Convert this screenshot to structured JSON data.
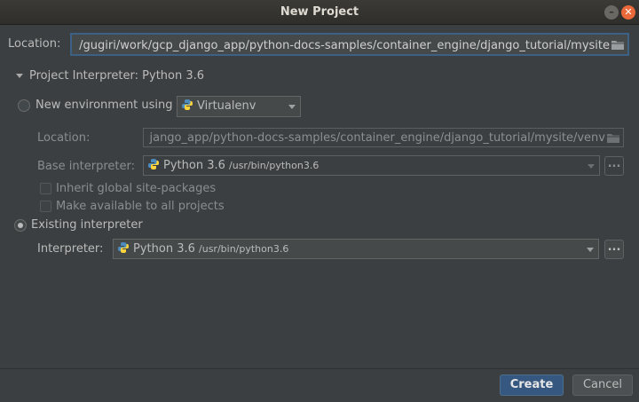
{
  "window": {
    "title": "New Project"
  },
  "location": {
    "label": "Location:",
    "value": "/gugiri/work/gcp_django_app/python-docs-samples/container_engine/django_tutorial/mysite"
  },
  "interpreter_section": {
    "label": "Project Interpreter: Python 3.6"
  },
  "new_env": {
    "radio_label": "New environment using",
    "tool_selected": "Virtualenv",
    "location_label": "Location:",
    "location_value": "jango_app/python-docs-samples/container_engine/django_tutorial/mysite/venv",
    "base_label": "Base interpreter:",
    "base_name": "Python 3.6",
    "base_path": "/usr/bin/python3.6",
    "inherit_label": "Inherit global site-packages",
    "make_available_label": "Make available to all projects"
  },
  "existing": {
    "radio_label": "Existing interpreter",
    "interpreter_label": "Interpreter:",
    "interpreter_name": "Python 3.6",
    "interpreter_path": "/usr/bin/python3.6",
    "browse_label": "..."
  },
  "buttons": {
    "create": "Create",
    "cancel": "Cancel"
  },
  "icons": {
    "close": "close-icon",
    "minimize": "minimize-icon",
    "folder": "folder-icon",
    "python": "python-icon"
  },
  "colors": {
    "accent": "#365880",
    "focus": "#3d6185",
    "close": "#e9693a"
  }
}
